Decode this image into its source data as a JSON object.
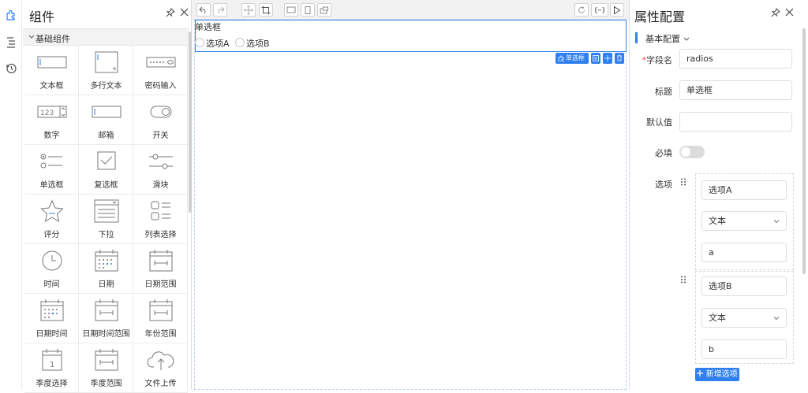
{
  "components_panel": {
    "title": "组件",
    "group_label": "基础组件",
    "items": [
      {
        "label": "文本框",
        "icon": "text-input-icon"
      },
      {
        "label": "多行文本",
        "icon": "textarea-icon"
      },
      {
        "label": "密码输入",
        "icon": "password-icon"
      },
      {
        "label": "数字",
        "icon": "number-icon",
        "icon_text": "123"
      },
      {
        "label": "邮箱",
        "icon": "email-icon"
      },
      {
        "label": "开关",
        "icon": "switch-icon"
      },
      {
        "label": "单选框",
        "icon": "radio-icon"
      },
      {
        "label": "复选框",
        "icon": "checkbox-icon"
      },
      {
        "label": "滑块",
        "icon": "slider-icon"
      },
      {
        "label": "评分",
        "icon": "star-icon"
      },
      {
        "label": "下拉",
        "icon": "select-icon"
      },
      {
        "label": "列表选择",
        "icon": "list-select-icon"
      },
      {
        "label": "时间",
        "icon": "clock-icon"
      },
      {
        "label": "日期",
        "icon": "calendar-icon"
      },
      {
        "label": "日期范围",
        "icon": "date-range-icon"
      },
      {
        "label": "日期时间",
        "icon": "datetime-icon"
      },
      {
        "label": "日期时间范围",
        "icon": "datetime-range-icon"
      },
      {
        "label": "年份范围",
        "icon": "year-range-icon"
      },
      {
        "label": "季度选择",
        "icon": "quarter-icon",
        "icon_text": "1"
      },
      {
        "label": "季度范围",
        "icon": "quarter-range-icon"
      },
      {
        "label": "文件上传",
        "icon": "upload-icon"
      }
    ]
  },
  "canvas": {
    "field_title": "单选框",
    "options": [
      "选项A",
      "选项B"
    ],
    "action_label": "单选框"
  },
  "props_panel": {
    "title": "属性配置",
    "section": "基本配置",
    "field_name_label": "字段名",
    "field_name_required": "*",
    "field_name_value": "radios",
    "title_label": "标题",
    "title_value": "单选框",
    "default_label": "默认值",
    "default_value": "",
    "required_label": "必填",
    "options_label": "选项",
    "option_items": [
      {
        "label": "选项A",
        "type": "文本",
        "value": "a"
      },
      {
        "label": "选项B",
        "type": "文本",
        "value": "b"
      }
    ],
    "add_option_label": "新增选项"
  },
  "colors": {
    "accent": "#2f7ff0",
    "icon_stroke": "#7a7a7a"
  }
}
